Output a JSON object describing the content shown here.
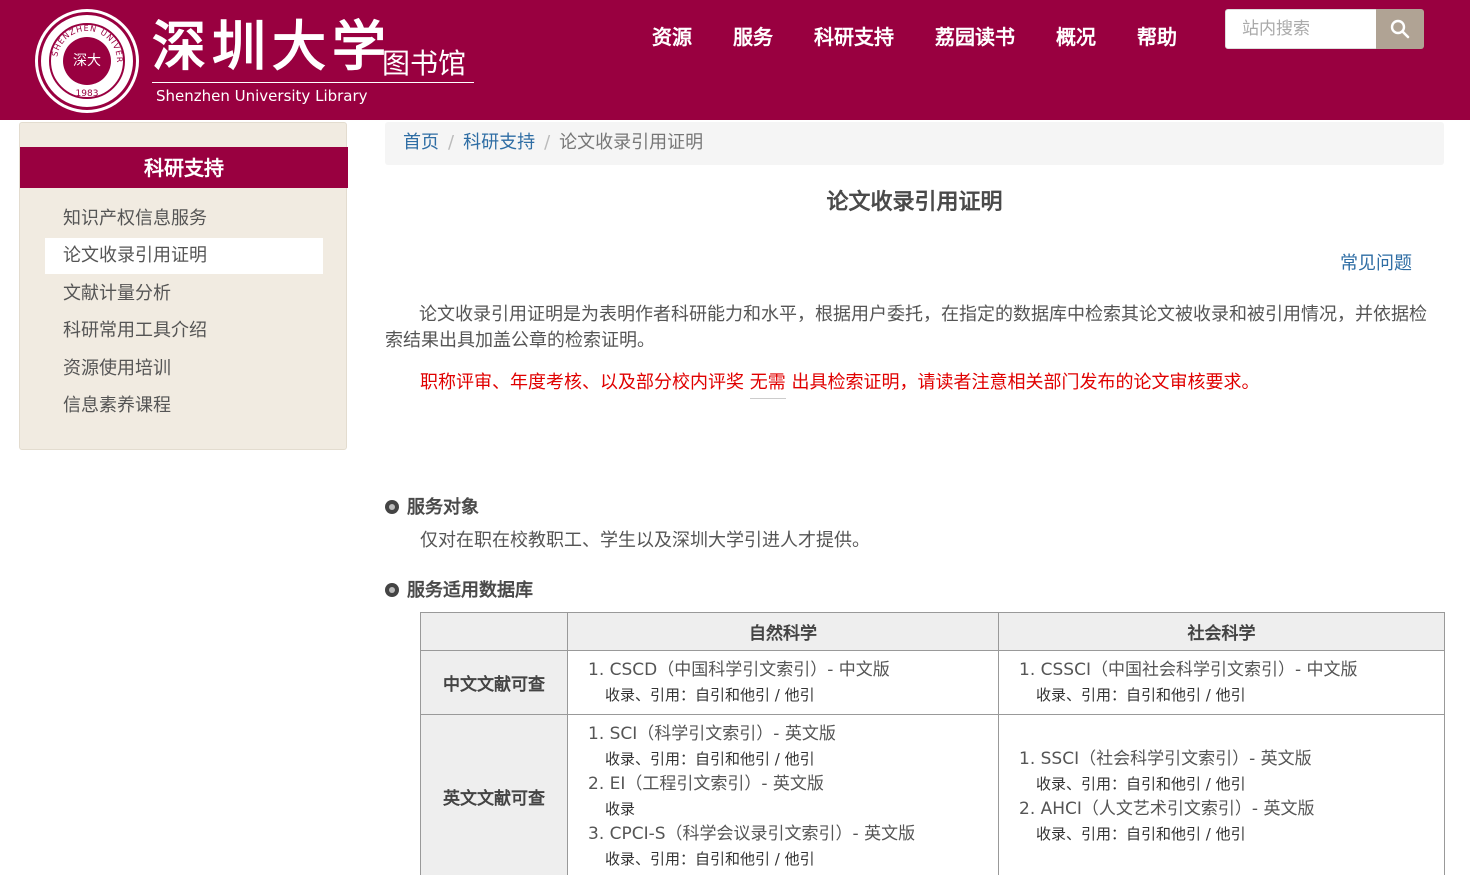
{
  "header": {
    "seal_text": "深大",
    "seal_year": "1983",
    "seal_ring_text": "SHENZHEN UNIVERSITY",
    "name_cn": "深圳大学",
    "name_sub": "图书馆",
    "name_en": "Shenzhen University Library",
    "nav": [
      "资源",
      "服务",
      "科研支持",
      "荔园读书",
      "概况",
      "帮助"
    ],
    "search_placeholder": "站内搜索"
  },
  "sidebar": {
    "title": "科研支持",
    "items": [
      "知识产权信息服务",
      "论文收录引用证明",
      "文献计量分析",
      "科研常用工具介绍",
      "资源使用培训",
      "信息素养课程"
    ],
    "active_index": 1
  },
  "breadcrumb": [
    "首页",
    "科研支持",
    "论文收录引用证明"
  ],
  "main": {
    "title": "论文收录引用证明",
    "faq": "常见问题",
    "intro": "论文收录引用证明是为表明作者科研能力和水平，根据用户委托，在指定的数据库中检索其论文被收录和被引用情况，并依据检索结果出具加盖公章的检索证明。",
    "notice_pre": "职称评审、年度考核、以及部分校内评奖 ",
    "notice_emph": "无需",
    "notice_post": " 出具检索证明，请读者注意相关部门发布的论文审核要求。",
    "sections": [
      {
        "title": "服务对象",
        "text": "仅对在职在校教职工、学生以及深圳大学引进人才提供。"
      },
      {
        "title": "服务适用数据库"
      }
    ]
  },
  "table": {
    "headers": [
      "",
      "自然科学",
      "社会科学"
    ],
    "rows": [
      {
        "label": "中文文献可查",
        "natural": [
          {
            "name": "1. CSCD（中国科学引文索引）- 中文版",
            "detail": "收录、引用：自引和他引 / 他引"
          }
        ],
        "social": [
          {
            "name": "1. CSSCI（中国社会科学引文索引）- 中文版",
            "detail": "收录、引用：自引和他引 / 他引"
          }
        ]
      },
      {
        "label": "英文文献可查",
        "natural": [
          {
            "name": "1. SCI（科学引文索引）- 英文版",
            "detail": "收录、引用：自引和他引 / 他引"
          },
          {
            "name": "2. EI（工程引文索引）- 英文版",
            "detail": "收录"
          },
          {
            "name": "3. CPCI-S（科学会议录引文索引）- 英文版",
            "detail": "收录、引用：自引和他引 / 他引"
          }
        ],
        "social": [
          {
            "name": "1. SSCI（社会科学引文索引）- 英文版",
            "detail": "收录、引用：自引和他引 / 他引"
          },
          {
            "name": "2. AHCI（人文艺术引文索引）- 英文版",
            "detail": "收录、引用：自引和他引 / 他引"
          }
        ]
      }
    ]
  },
  "colors": {
    "brand": "#990040",
    "link": "#2e6da4",
    "notice": "#e00000",
    "sidebar_bg": "#f1ebe1"
  },
  "icons": [
    "search-icon",
    "bullet-icon"
  ]
}
